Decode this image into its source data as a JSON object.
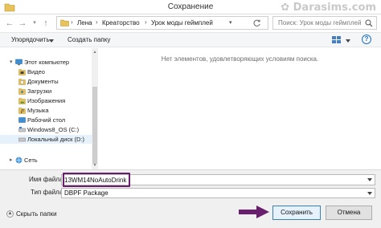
{
  "window": {
    "title": "Сохранение",
    "watermark": "Darasims.com"
  },
  "address": {
    "crumbs": [
      "Лена",
      "Креаторство",
      "Урок моды геймплей"
    ],
    "search_placeholder": "Поиск: Урок моды геймплей"
  },
  "toolbar": {
    "organize_label": "Упорядочить",
    "new_folder_label": "Создать папку"
  },
  "sidebar": {
    "items": [
      {
        "label": "Этот компьютер",
        "icon": "computer-icon"
      },
      {
        "label": "Видео",
        "icon": "video-folder-icon"
      },
      {
        "label": "Документы",
        "icon": "documents-folder-icon"
      },
      {
        "label": "Загрузки",
        "icon": "downloads-folder-icon"
      },
      {
        "label": "Изображения",
        "icon": "pictures-folder-icon"
      },
      {
        "label": "Музыка",
        "icon": "music-folder-icon"
      },
      {
        "label": "Рабочий стол",
        "icon": "desktop-folder-icon"
      },
      {
        "label": "Windows8_OS (C:)",
        "icon": "drive-c-icon"
      },
      {
        "label": "Локальный диск (D:)",
        "icon": "drive-d-icon"
      },
      {
        "label": "Сеть",
        "icon": "network-icon"
      }
    ]
  },
  "content": {
    "empty_message": "Нет элементов, удовлетворяющих условиям поиска."
  },
  "form": {
    "filename_label": "Имя файла:",
    "filename_value": "13WM14NoAutoDrink",
    "filetype_label": "Тип файла:",
    "filetype_value": "DBPF Package"
  },
  "footer": {
    "hide_folders_label": "Скрыть папки",
    "save_label": "Сохранить",
    "cancel_label": "Отмена"
  },
  "colors": {
    "annotation": "#6a1e6e",
    "selection": "#e5f1fb",
    "primary_border": "#3c7fb1"
  }
}
